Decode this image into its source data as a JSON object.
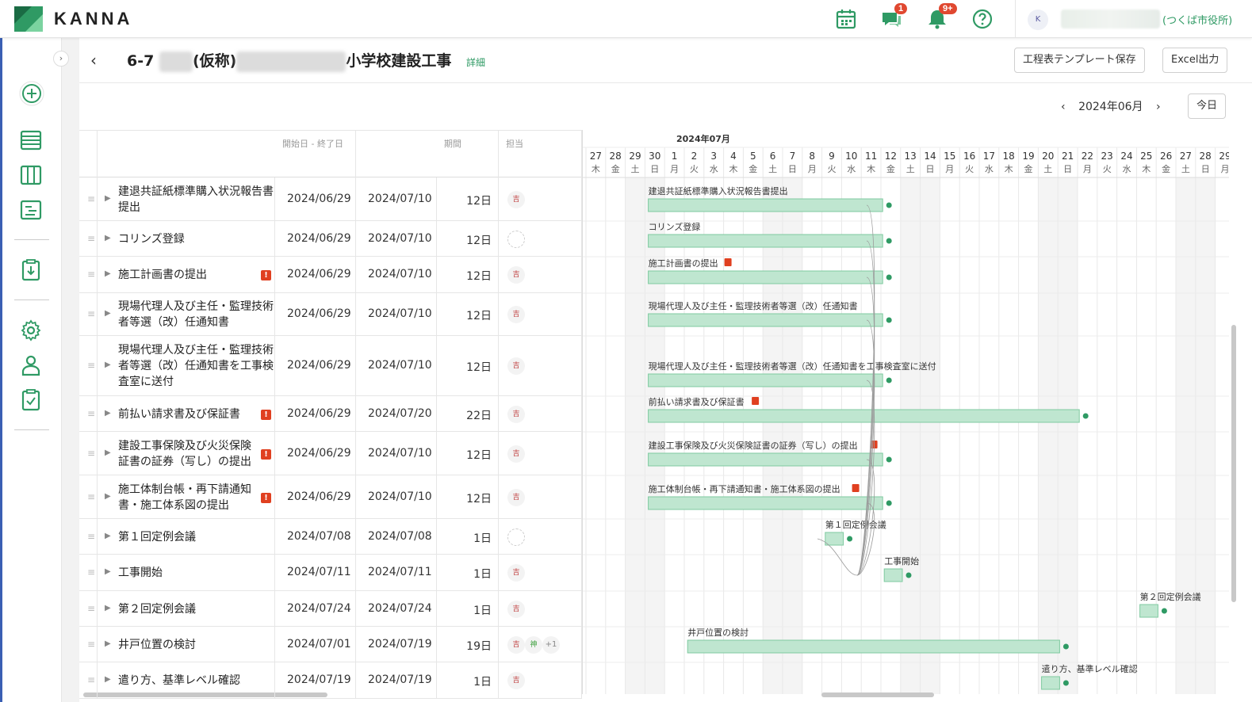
{
  "app": {
    "logo": "KANNA"
  },
  "topbar": {
    "chat_badge": "1",
    "bell_badge": "9+",
    "avatar_initial": "K",
    "org_label": "(つくば市役所)"
  },
  "page": {
    "title_prefix": "6-7",
    "title_mid": "(仮称)",
    "title_suffix": "小学校建設工事",
    "detail_link": "詳細",
    "save_template_button": "工程表テンプレート保存",
    "excel_button": "Excel出力",
    "month_label": "2024年06月",
    "today_button": "今日"
  },
  "columns": {
    "dates": "開始日 - 終了日",
    "duration": "期間",
    "assignee": "担当"
  },
  "timeline": {
    "month_header": "2024年07月",
    "days": [
      {
        "d": "27",
        "w": "木"
      },
      {
        "d": "28",
        "w": "金"
      },
      {
        "d": "29",
        "w": "土"
      },
      {
        "d": "30",
        "w": "日"
      },
      {
        "d": "1",
        "w": "月"
      },
      {
        "d": "2",
        "w": "火"
      },
      {
        "d": "3",
        "w": "水"
      },
      {
        "d": "4",
        "w": "木"
      },
      {
        "d": "5",
        "w": "金"
      },
      {
        "d": "6",
        "w": "土"
      },
      {
        "d": "7",
        "w": "日"
      },
      {
        "d": "8",
        "w": "月"
      },
      {
        "d": "9",
        "w": "火"
      },
      {
        "d": "10",
        "w": "水"
      },
      {
        "d": "11",
        "w": "木"
      },
      {
        "d": "12",
        "w": "金"
      },
      {
        "d": "13",
        "w": "土"
      },
      {
        "d": "14",
        "w": "日"
      },
      {
        "d": "15",
        "w": "月"
      },
      {
        "d": "16",
        "w": "火"
      },
      {
        "d": "17",
        "w": "水"
      },
      {
        "d": "18",
        "w": "木"
      },
      {
        "d": "19",
        "w": "金"
      },
      {
        "d": "20",
        "w": "土"
      },
      {
        "d": "21",
        "w": "日"
      },
      {
        "d": "22",
        "w": "月"
      },
      {
        "d": "23",
        "w": "火"
      },
      {
        "d": "24",
        "w": "水"
      },
      {
        "d": "25",
        "w": "木"
      },
      {
        "d": "26",
        "w": "金"
      },
      {
        "d": "27",
        "w": "土"
      },
      {
        "d": "28",
        "w": "日"
      },
      {
        "d": "29",
        "w": "月"
      }
    ]
  },
  "colors": {
    "accent": "#2f9a64",
    "bar": "#bfe6d0",
    "bar_border": "#7fcaa0",
    "weekend": "#f4f4f4",
    "warn": "#e04020"
  },
  "tasks": [
    {
      "name": "建退共証紙標準購入状況報告書提出",
      "bar_label": "建退共証紙標準購入状況報告書提出",
      "start": "2024/06/29",
      "end": "2024/07/10",
      "dur": "12日",
      "assignee": "吉",
      "warn": false
    },
    {
      "name": "コリンズ登録",
      "bar_label": "コリンズ登録",
      "start": "2024/06/29",
      "end": "2024/07/10",
      "dur": "12日",
      "assignee": "",
      "warn": false
    },
    {
      "name": "施工計画書の提出",
      "bar_label": "施工計画書の提出",
      "start": "2024/06/29",
      "end": "2024/07/10",
      "dur": "12日",
      "assignee": "吉",
      "warn": true
    },
    {
      "name": "現場代理人及び主任・監理技術者等選（改）任通知書",
      "bar_label": "現場代理人及び主任・監理技術者等選（改）任通知書",
      "start": "2024/06/29",
      "end": "2024/07/10",
      "dur": "12日",
      "assignee": "吉",
      "warn": false
    },
    {
      "name": "現場代理人及び主任・監理技術者等選（改）任通知書を工事検査室に送付",
      "bar_label": "現場代理人及び主任・監理技術者等選（改）任通知書を工事検査室に送付",
      "start": "2024/06/29",
      "end": "2024/07/10",
      "dur": "12日",
      "assignee": "吉",
      "warn": false
    },
    {
      "name": "前払い請求書及び保証書",
      "bar_label": "前払い請求書及び保証書",
      "start": "2024/06/29",
      "end": "2024/07/20",
      "dur": "22日",
      "assignee": "吉",
      "warn": true
    },
    {
      "name": "建設工事保険及び火災保険証書の証券（写し）の提出",
      "bar_label": "建設工事保険及び火災保険証書の証券（写し）の提出",
      "start": "2024/06/29",
      "end": "2024/07/10",
      "dur": "12日",
      "assignee": "吉",
      "warn": true
    },
    {
      "name": "施工体制台帳・再下請通知書・施工体系図の提出",
      "bar_label": "施工体制台帳・再下請通知書・施工体系図の提出",
      "start": "2024/06/29",
      "end": "2024/07/10",
      "dur": "12日",
      "assignee": "吉",
      "warn": true
    },
    {
      "name": "第１回定例会議",
      "bar_label": "第１回定例会議",
      "start": "2024/07/08",
      "end": "2024/07/08",
      "dur": "1日",
      "assignee": "",
      "warn": false
    },
    {
      "name": "工事開始",
      "bar_label": "工事開始",
      "start": "2024/07/11",
      "end": "2024/07/11",
      "dur": "1日",
      "assignee": "吉",
      "warn": false
    },
    {
      "name": "第２回定例会議",
      "bar_label": "第２回定例会議",
      "start": "2024/07/24",
      "end": "2024/07/24",
      "dur": "1日",
      "assignee": "吉",
      "warn": false
    },
    {
      "name": "井戸位置の検討",
      "bar_label": "井戸位置の検討",
      "start": "2024/07/01",
      "end": "2024/07/19",
      "dur": "19日",
      "assignee": "吉",
      "assignee2": "神",
      "more": "+1",
      "warn": false
    },
    {
      "name": "遣り方、基準レベル確認",
      "bar_label": "遣り方、基準レベル確認",
      "start": "2024/07/19",
      "end": "2024/07/19",
      "dur": "1日",
      "assignee": "吉",
      "warn": false
    }
  ]
}
